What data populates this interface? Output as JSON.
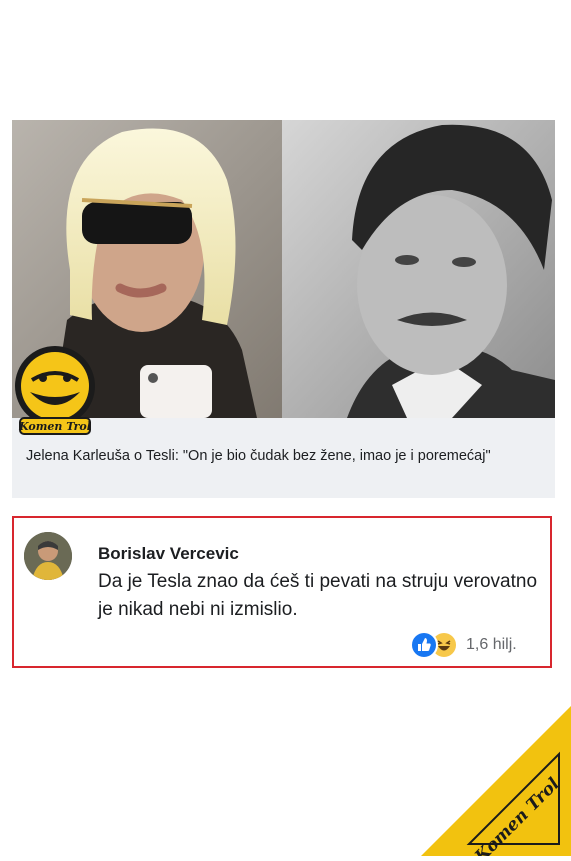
{
  "post": {
    "caption": "Jelena Karleuša o Tesli: \"On je bio čudak bez žene, imao je i poremećaj\""
  },
  "comment": {
    "author": "Borislav Vercevic",
    "text": "Da je Tesla znao da ćeš ti pevati na struju verovatno je nikad nebi ni izmislio.",
    "reactions": {
      "icons": [
        "like-icon",
        "haha-icon"
      ],
      "count": "1,6 hilj."
    }
  },
  "watermark": {
    "brand": "Komen Trol"
  },
  "colors": {
    "comment_border": "#d8262e",
    "like": "#1877f2",
    "haha": "#f7c84a",
    "logo_yellow": "#f5c518"
  }
}
